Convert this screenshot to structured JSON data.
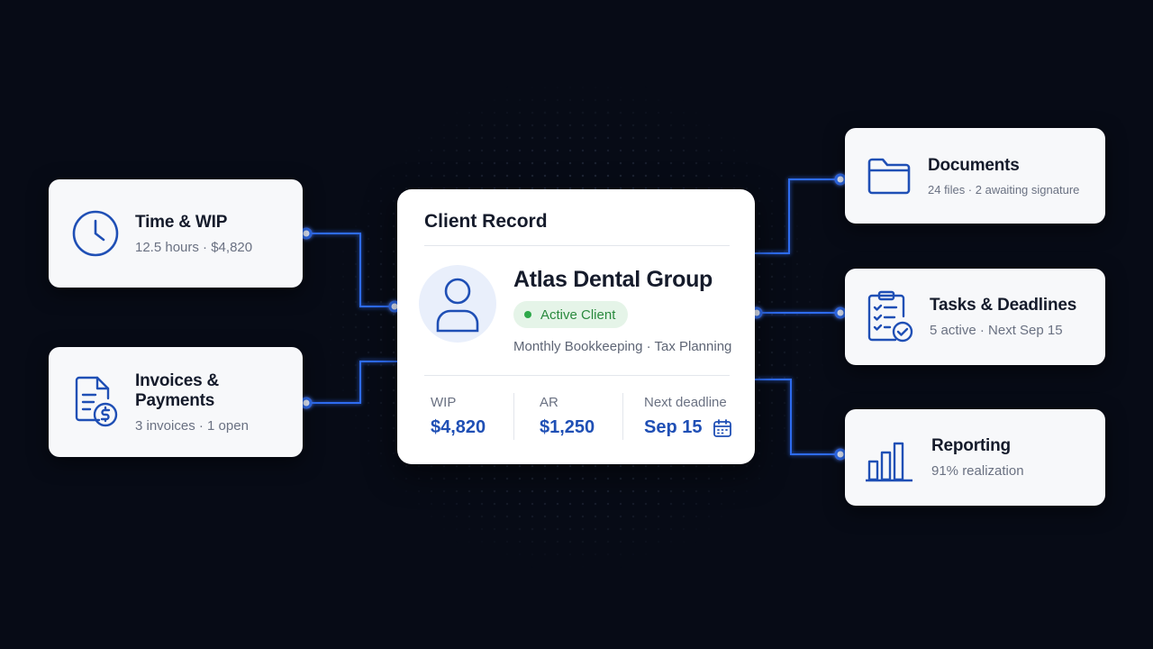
{
  "center": {
    "title": "Client Record",
    "client_name": "Atlas Dental Group",
    "status": "Active Client",
    "services": "Monthly Bookkeeping · Tax Planning",
    "stats": [
      {
        "label": "WIP",
        "value": "$4,820"
      },
      {
        "label": "AR",
        "value": "$1,250"
      },
      {
        "label": "Next deadline",
        "value": "Sep 15"
      }
    ]
  },
  "cards": {
    "time_wip": {
      "title": "Time & WIP",
      "subtitle": "12.5 hours · $4,820",
      "icon": "clock-icon"
    },
    "invoices": {
      "title": "Invoices & Payments",
      "subtitle": "3 invoices · 1 open",
      "icon": "invoice-dollar-icon"
    },
    "documents": {
      "title": "Documents",
      "subtitle": "24 files · 2 awaiting signature",
      "icon": "folder-icon"
    },
    "tasks": {
      "title": "Tasks & Deadlines",
      "subtitle": "5 active · Next Sep 15",
      "icon": "checklist-icon"
    },
    "reporting": {
      "title": "Reporting",
      "subtitle": "91% realization",
      "icon": "bar-chart-icon"
    }
  },
  "colors": {
    "accent": "#1f4fb5",
    "wire": "#2f6cf0",
    "success": "#2ea84a",
    "background": "#070b16"
  }
}
